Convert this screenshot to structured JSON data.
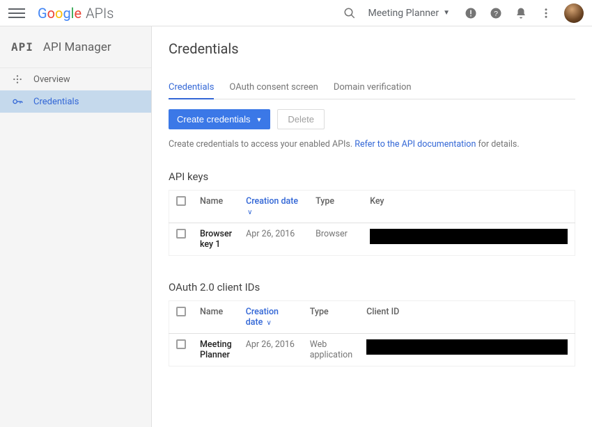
{
  "topbar": {
    "logo_suffix": "APIs",
    "project_name": "Meeting Planner"
  },
  "sidebar": {
    "title": "API Manager",
    "items": [
      {
        "label": "Overview"
      },
      {
        "label": "Credentials"
      }
    ]
  },
  "page": {
    "title": "Credentials",
    "tabs": [
      {
        "label": "Credentials"
      },
      {
        "label": "OAuth consent screen"
      },
      {
        "label": "Domain verification"
      }
    ],
    "create_button": "Create credentials",
    "delete_button": "Delete",
    "hint_prefix": "Create credentials to access your enabled APIs. ",
    "hint_link": "Refer to the API documentation",
    "hint_suffix": " for details."
  },
  "api_keys": {
    "section_title": "API keys",
    "headers": {
      "name": "Name",
      "creation_date": "Creation date",
      "type": "Type",
      "key": "Key"
    },
    "rows": [
      {
        "name": "Browser key 1",
        "date": "Apr 26, 2016",
        "type": "Browser"
      }
    ]
  },
  "oauth": {
    "section_title": "OAuth 2.0 client IDs",
    "headers": {
      "name": "Name",
      "creation_date": "Creation date",
      "type": "Type",
      "client_id": "Client ID"
    },
    "rows": [
      {
        "name": "Meeting Planner",
        "date": "Apr 26, 2016",
        "type": "Web application"
      }
    ]
  }
}
